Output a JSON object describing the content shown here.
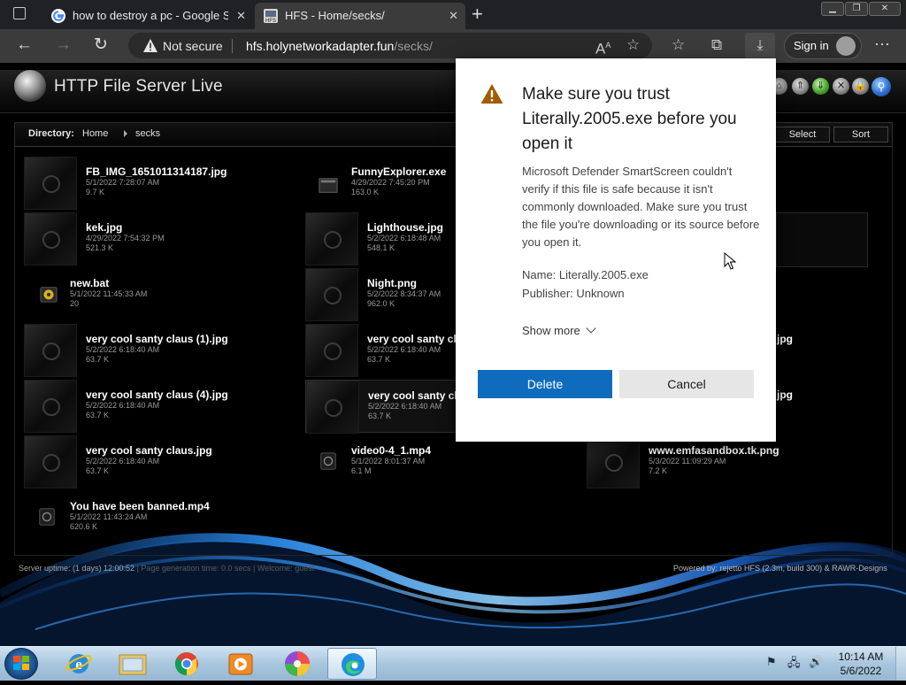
{
  "browser": {
    "tabs": [
      {
        "title": "how to destroy a pc - Google Se",
        "favicon": "google-icon"
      },
      {
        "title": "HFS - Home/secks/",
        "favicon": "hfs-icon"
      }
    ],
    "not_secure_label": "Not secure",
    "url_host": "hfs.holynetworkadapter.fun",
    "url_path": "/secks/",
    "sign_in_label": "Sign in"
  },
  "hfs": {
    "brand": "HTTP File Server Live",
    "directory_label": "Directory:",
    "crumbs": [
      "Home",
      "secks"
    ],
    "select_label": "Select",
    "sort_label": "Sort",
    "files": [
      {
        "name": "FB_IMG_1651011314187.jpg",
        "date": "5/1/2022 7:28:07 AM",
        "size": "9.7 K"
      },
      {
        "name": "FunnyExplorer.exe",
        "date": "4/29/2022 7:45:20 PM",
        "size": "163.0 K"
      },
      {
        "name": "kek.jpg",
        "date": "4/29/2022 7:54:32 PM",
        "size": "521.3 K"
      },
      {
        "name": "Lighthouse.jpg",
        "date": "5/2/2022 6:18:48 AM",
        "size": "548.1 K"
      },
      {
        "name": "new.bat",
        "date": "5/1/2022 11:45:33 AM",
        "size": "20"
      },
      {
        "name": "Night.png",
        "date": "5/2/2022 8:34:37 AM",
        "size": "962.0 K"
      },
      {
        "name": "very cool santy claus (1).jpg",
        "date": "5/2/2022 6:18:40 AM",
        "size": "63.7 K"
      },
      {
        "name": "very cool santy cl",
        "date": "5/2/2022 6:18:40 AM",
        "size": "63.7 K"
      },
      {
        "name": "very cool santy claus (4).jpg",
        "date": "5/2/2022 6:18:40 AM",
        "size": "63.7 K"
      },
      {
        "name": "very cool santy cl",
        "date": "5/2/2022 6:18:40 AM",
        "size": "63.7 K"
      },
      {
        "name": "very cool santy claus.jpg",
        "date": "5/2/2022 6:18:40 AM",
        "size": "63.7 K"
      },
      {
        "name": "video0-4_1.mp4",
        "date": "5/1/2022 8:01:37 AM",
        "size": "6.1 M"
      },
      {
        "name": "www.emfasandbox.tk.png",
        "date": "5/3/2022 11:09:29 AM",
        "size": "7.2 K"
      },
      {
        "name": "You have been banned.mp4",
        "date": "5/1/2022 11:43:24 AM",
        "size": "620.6 K"
      }
    ],
    "partial_right_1": "jpg",
    "partial_right_2": "jpg",
    "footer_left_a": "Server uptime: (1 days) 12:00:52",
    "footer_left_b": "|  Page generation time:  0.0 secs  |  Welcome:  guest",
    "footer_right": "Powered by: rejetto HFS (2.3m, build 300) & RAWR-Designs"
  },
  "dialog": {
    "title": "Make sure you trust Literally.2005.exe before you open it",
    "body": "Microsoft Defender SmartScreen couldn't verify if this file is safe because it isn't commonly downloaded. Make sure you trust the file you're downloading or its source before you open it.",
    "name_line": "Name: Literally.2005.exe",
    "publisher_line": "Publisher: Unknown",
    "show_more": "Show more",
    "delete_label": "Delete",
    "cancel_label": "Cancel"
  },
  "taskbar": {
    "apps": [
      "internet-explorer-icon",
      "file-explorer-icon",
      "chrome-icon",
      "media-player-icon",
      "photos-icon",
      "edge-icon"
    ],
    "time": "10:14 AM",
    "date": "5/6/2022"
  }
}
